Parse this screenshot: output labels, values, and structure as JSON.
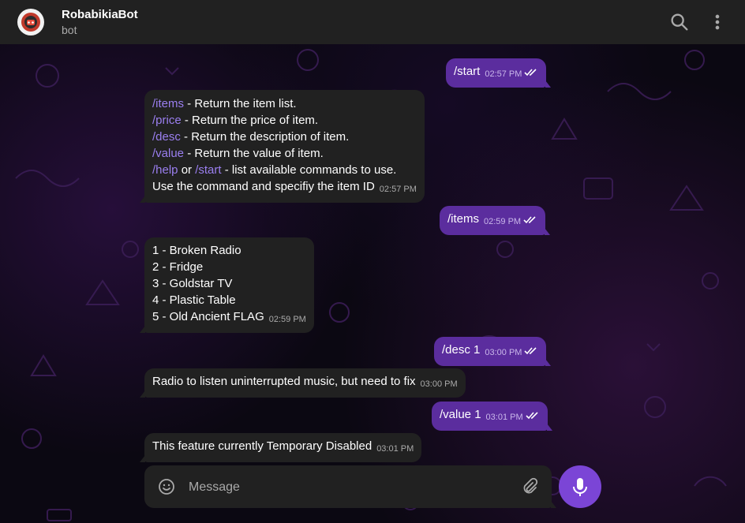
{
  "header": {
    "title": "RobabikiaBot",
    "status": "bot",
    "avatar_icon": "robot-logo-icon",
    "actions": [
      "search-icon",
      "more-vert-icon"
    ]
  },
  "messages": [
    {
      "dir": "out",
      "text": "/start",
      "time": "02:57 PM"
    },
    {
      "dir": "in",
      "time": "02:57 PM",
      "lines": [
        {
          "cmd": "/items",
          "rest": " - Return the item list."
        },
        {
          "cmd": "/price",
          "rest": " - Return the price of item."
        },
        {
          "cmd": "/desc",
          "rest": " - Return the description of item."
        },
        {
          "cmd": "/value",
          "rest": " - Return the value of item."
        },
        {
          "cmd": "/help",
          "mid": " or ",
          "cmd2": "/start",
          "rest": " - list available commands to use."
        },
        {
          "rest": "Use the command and specifiy the item ID"
        }
      ]
    },
    {
      "dir": "out",
      "text": "/items",
      "time": "02:59 PM"
    },
    {
      "dir": "in",
      "time": "02:59 PM",
      "lines": [
        {
          "rest": "1 - Broken Radio"
        },
        {
          "rest": "2 - Fridge"
        },
        {
          "rest": "3 - Goldstar TV"
        },
        {
          "rest": "4 - Plastic Table"
        },
        {
          "rest": "5 - Old Ancient FLAG"
        }
      ]
    },
    {
      "dir": "out",
      "text": "/desc 1",
      "time": "03:00 PM"
    },
    {
      "dir": "in",
      "text": "Radio to listen uninterrupted music, but need to fix",
      "time": "03:00 PM"
    },
    {
      "dir": "out",
      "text": "/value 1",
      "time": "03:01 PM"
    },
    {
      "dir": "in",
      "text": "This feature currently Temporary Disabled",
      "time": "03:01 PM"
    }
  ],
  "composer": {
    "placeholder": "Message",
    "emoji_icon": "emoji-icon",
    "attach_icon": "paperclip-icon",
    "mic_icon": "microphone-icon"
  },
  "colors": {
    "header_bg": "#212121",
    "incoming_bg": "#212121",
    "outgoing_bg": "#5b2d9e",
    "command_link": "#9b7ff0",
    "mic_button": "#7b45d6"
  }
}
